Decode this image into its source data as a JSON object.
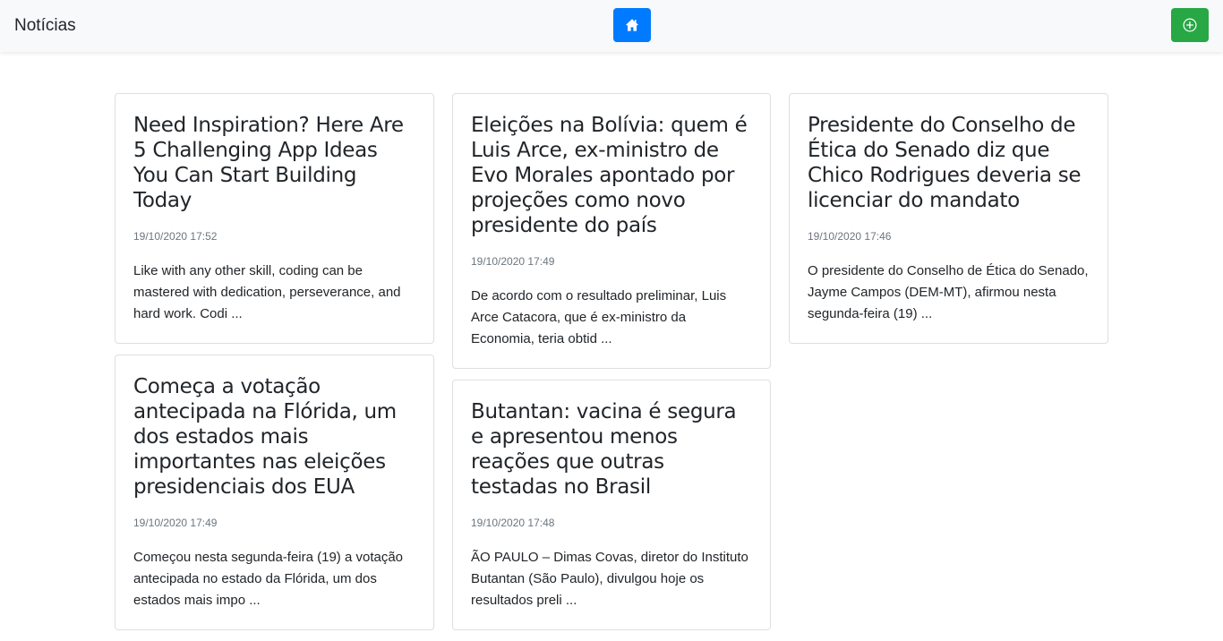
{
  "navbar": {
    "brand": "Notícias",
    "home_button_icon": "house-icon",
    "add_button_icon": "plus-circle-icon",
    "home_color": "#007bff",
    "add_color": "#28a745"
  },
  "columns": [
    [
      {
        "title": "Need Inspiration? Here Are 5 Challenging App Ideas You Can Start Building Today",
        "date": "19/10/2020 17:52",
        "excerpt": "Like with any other skill, coding can be mastered with dedication, perseverance, and hard work. Codi ..."
      },
      {
        "title": "Começa a votação antecipada na Flórida, um dos estados mais importantes nas eleições presidenciais dos EUA",
        "date": "19/10/2020 17:49",
        "excerpt": "Começou nesta segunda-feira (19) a votação antecipada no estado da Flórida, um dos estados mais impo ..."
      }
    ],
    [
      {
        "title": "Eleições na Bolívia: quem é Luis Arce, ex-ministro de Evo Morales apontado por projeções como novo presidente do país",
        "date": "19/10/2020 17:49",
        "excerpt": "De acordo com o resultado preliminar, Luis Arce Catacora, que é ex-ministro da Economia, teria obtid ..."
      },
      {
        "title": "Butantan: vacina é segura e apresentou menos reações que outras testadas no Brasil",
        "date": "19/10/2020 17:48",
        "excerpt": "ÃO PAULO – Dimas Covas, diretor do Instituto Butantan (São Paulo), divulgou hoje os resultados preli ..."
      }
    ],
    [
      {
        "title": "Presidente do Conselho de Ética do Senado diz que Chico Rodrigues deveria se licenciar do mandato",
        "date": "19/10/2020 17:46",
        "excerpt": "O presidente do Conselho de Ética do Senado, Jayme Campos (DEM-MT), afirmou nesta segunda-feira (19) ..."
      }
    ]
  ]
}
